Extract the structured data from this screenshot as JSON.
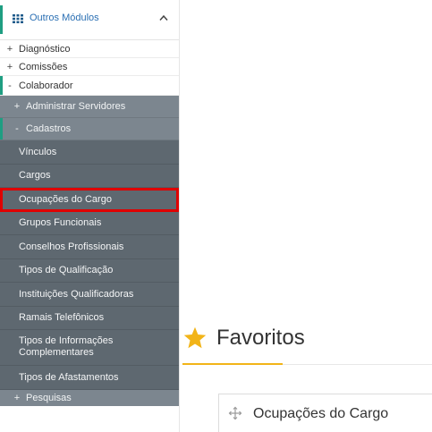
{
  "sidebar": {
    "header": {
      "title": "Outros Módulos",
      "icon": "grid-icon",
      "chevron": "chevron-up-icon",
      "accent_color": "#1f9e82"
    },
    "level1": [
      {
        "sign": "+",
        "label": "Diagnóstico"
      },
      {
        "sign": "+",
        "label": "Comissões"
      },
      {
        "sign": "-",
        "label": "Colaborador"
      }
    ],
    "level2": [
      {
        "sign": "+",
        "label": "Administrar Servidores"
      },
      {
        "sign": "-",
        "label": "Cadastros"
      }
    ],
    "level3": [
      {
        "label": "Vínculos"
      },
      {
        "label": "Cargos"
      },
      {
        "label": "Ocupações do Cargo"
      },
      {
        "label": "Grupos Funcionais"
      },
      {
        "label": "Conselhos Profissionais"
      },
      {
        "label": "Tipos de Qualificação"
      },
      {
        "label": "Instituições Qualificadoras"
      },
      {
        "label": "Ramais Telefônicos"
      },
      {
        "label": "Tipos de Informações\nComplementares"
      },
      {
        "label": "Tipos de Afastamentos"
      }
    ],
    "bottom": {
      "sign": "+",
      "label": "Pesquisas"
    },
    "highlight_color": "#e00000"
  },
  "favorites": {
    "title": "Favoritos",
    "star_icon": "star-icon",
    "star_color": "#f2b418",
    "items": [
      {
        "icon": "move-icon",
        "label": "Ocupações do Cargo"
      }
    ]
  }
}
